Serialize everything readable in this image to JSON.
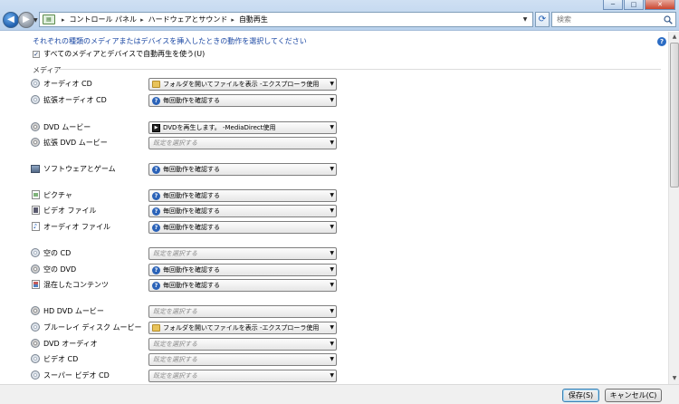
{
  "window": {
    "min_glyph": "─",
    "max_glyph": "□",
    "close_glyph": "✕"
  },
  "address_bar": {
    "breadcrumbs": [
      "コントロール パネル",
      "ハードウェアとサウンド",
      "自動再生"
    ],
    "separator": "▸"
  },
  "search": {
    "placeholder": "検索"
  },
  "intro_text": "それぞれの種類のメディアまたはデバイスを挿入したときの動作を選択してください",
  "use_all_checkbox": {
    "label": "すべてのメディアとデバイスで自動再生を使う(U)",
    "checked": true,
    "check_glyph": "✓"
  },
  "section_title": "メディア",
  "items": [
    {
      "label": "オーディオ CD",
      "icon": "disc-icon",
      "value": "フォルダを開いてファイルを表示 -エクスプローラ使用",
      "value_icon": "folder-icon",
      "placeholder": false
    },
    {
      "label": "拡張オーディオ CD",
      "icon": "disc-icon",
      "value": "毎回動作を確認する",
      "value_icon": "ask-icon",
      "placeholder": false
    },
    {
      "label": "DVD ムービー",
      "icon": "dvd-icon",
      "value": "DVDを再生します。 -MediaDirect使用",
      "value_icon": "dvdapp-icon",
      "placeholder": false
    },
    {
      "label": "拡張 DVD ムービー",
      "icon": "dvd-icon",
      "value": "既定を選択する",
      "value_icon": "",
      "placeholder": true
    },
    {
      "label": "ソフトウェアとゲーム",
      "icon": "software-icon",
      "value": "毎回動作を確認する",
      "value_icon": "ask-icon",
      "placeholder": false
    },
    {
      "label": "ピクチャ",
      "icon": "picture-icon",
      "value": "毎回動作を確認する",
      "value_icon": "ask-icon",
      "placeholder": false
    },
    {
      "label": "ビデオ ファイル",
      "icon": "video-file-icon",
      "value": "毎回動作を確認する",
      "value_icon": "ask-icon",
      "placeholder": false
    },
    {
      "label": "オーディオ ファイル",
      "icon": "audio-file-icon",
      "value": "毎回動作を確認する",
      "value_icon": "ask-icon",
      "placeholder": false
    },
    {
      "label": "空の CD",
      "icon": "disc-icon",
      "value": "既定を選択する",
      "value_icon": "",
      "placeholder": true
    },
    {
      "label": "空の DVD",
      "icon": "dvd-icon",
      "value": "毎回動作を確認する",
      "value_icon": "ask-icon",
      "placeholder": false
    },
    {
      "label": "混在したコンテンツ",
      "icon": "mixed-content-icon",
      "value": "毎回動作を確認する",
      "value_icon": "ask-icon",
      "placeholder": false
    },
    {
      "label": "HD DVD ムービー",
      "icon": "dvd-icon",
      "value": "既定を選択する",
      "value_icon": "",
      "placeholder": true
    },
    {
      "label": "ブルーレイ ディスク ムービー",
      "icon": "disc-icon",
      "value": "フォルダを開いてファイルを表示 -エクスプローラ使用",
      "value_icon": "folder-icon",
      "placeholder": false
    },
    {
      "label": "DVD オーディオ",
      "icon": "dvd-icon",
      "value": "既定を選択する",
      "value_icon": "",
      "placeholder": true
    },
    {
      "label": "ビデオ CD",
      "icon": "disc-icon",
      "value": "既定を選択する",
      "value_icon": "",
      "placeholder": true
    },
    {
      "label": "スーパー ビデオ CD",
      "icon": "disc-icon",
      "value": "既定を選択する",
      "value_icon": "",
      "placeholder": true
    }
  ],
  "footer": {
    "save_label": "保存(S)",
    "cancel_label": "キャンセル(C)"
  }
}
